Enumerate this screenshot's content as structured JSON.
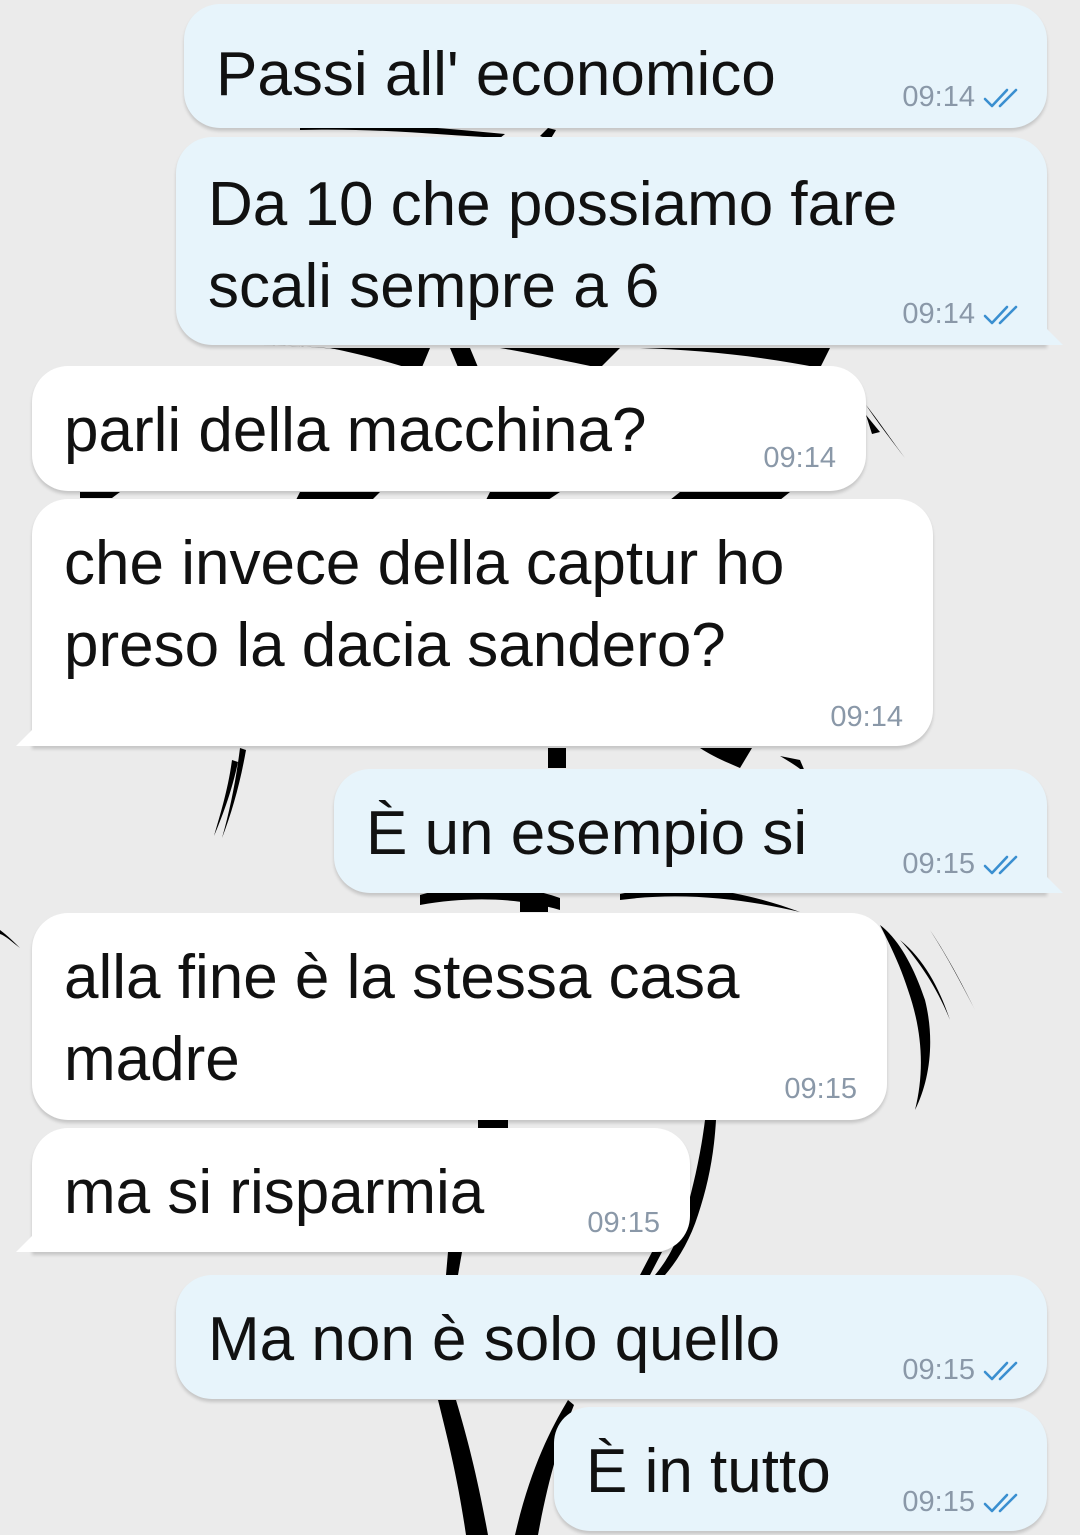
{
  "chat": {
    "colors": {
      "outgoing_bubble": "#e7f4fb",
      "incoming_bubble": "#ffffff",
      "timestamp": "#8a98a8",
      "read_ticks": "#3a8fd0",
      "wallpaper_background": "#ebebeb",
      "wallpaper_art": "#000000"
    },
    "wallpaper_icon": "palm-tree-silhouette",
    "messages": [
      {
        "direction": "outgoing",
        "text": "Passi all' economico",
        "time": "09:14",
        "status_icon": "double-check-icon"
      },
      {
        "direction": "outgoing",
        "text": "Da 10 che possiamo fare scali sempre a 6",
        "time": "09:14",
        "status_icon": "double-check-icon"
      },
      {
        "direction": "incoming",
        "text": "parli della macchina?",
        "time": "09:14"
      },
      {
        "direction": "incoming",
        "text": "che invece della captur ho preso la dacia sandero?",
        "time": "09:14"
      },
      {
        "direction": "outgoing",
        "text": "È un esempio si",
        "time": "09:15",
        "status_icon": "double-check-icon"
      },
      {
        "direction": "incoming",
        "text": "alla fine è la stessa casa madre",
        "time": "09:15"
      },
      {
        "direction": "incoming",
        "text": "ma si risparmia",
        "time": "09:15"
      },
      {
        "direction": "outgoing",
        "text": "Ma non è solo quello",
        "time": "09:15",
        "status_icon": "double-check-icon"
      },
      {
        "direction": "outgoing",
        "text": "È in tutto",
        "time": "09:15",
        "status_icon": "double-check-icon"
      }
    ]
  }
}
